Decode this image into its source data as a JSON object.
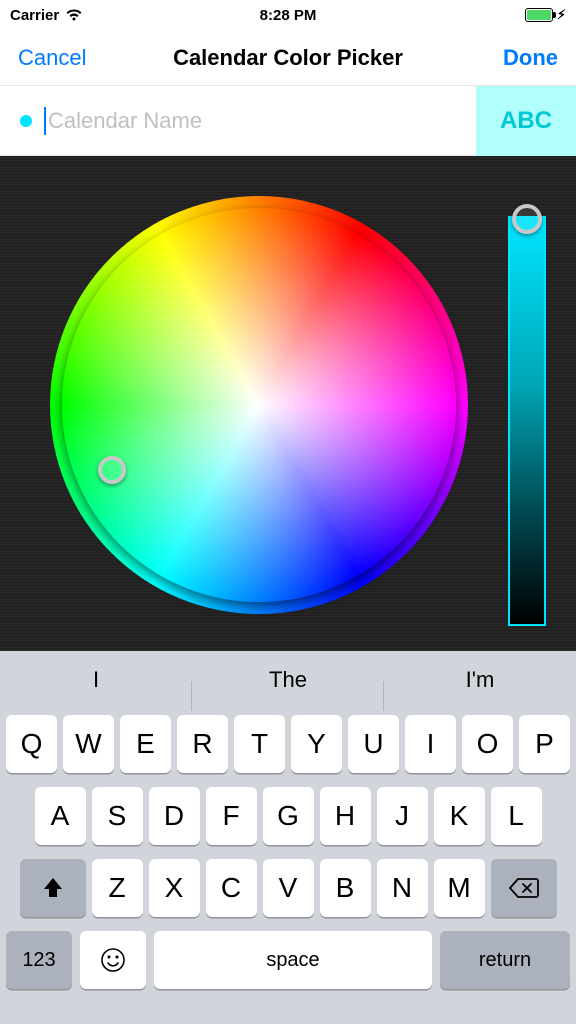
{
  "status": {
    "carrier": "Carrier",
    "time": "8:28 PM"
  },
  "nav": {
    "cancel": "Cancel",
    "title": "Calendar Color Picker",
    "done": "Done"
  },
  "input": {
    "placeholder": "Calendar Name",
    "value": "",
    "abc": "ABC",
    "selected_color": "#00e5ff"
  },
  "keyboard": {
    "suggestions": [
      "I",
      "The",
      "I'm"
    ],
    "row1": [
      "Q",
      "W",
      "E",
      "R",
      "T",
      "Y",
      "U",
      "I",
      "O",
      "P"
    ],
    "row2": [
      "A",
      "S",
      "D",
      "F",
      "G",
      "H",
      "J",
      "K",
      "L"
    ],
    "row3": [
      "Z",
      "X",
      "C",
      "V",
      "B",
      "N",
      "M"
    ],
    "numkey": "123",
    "space": "space",
    "return": "return"
  }
}
